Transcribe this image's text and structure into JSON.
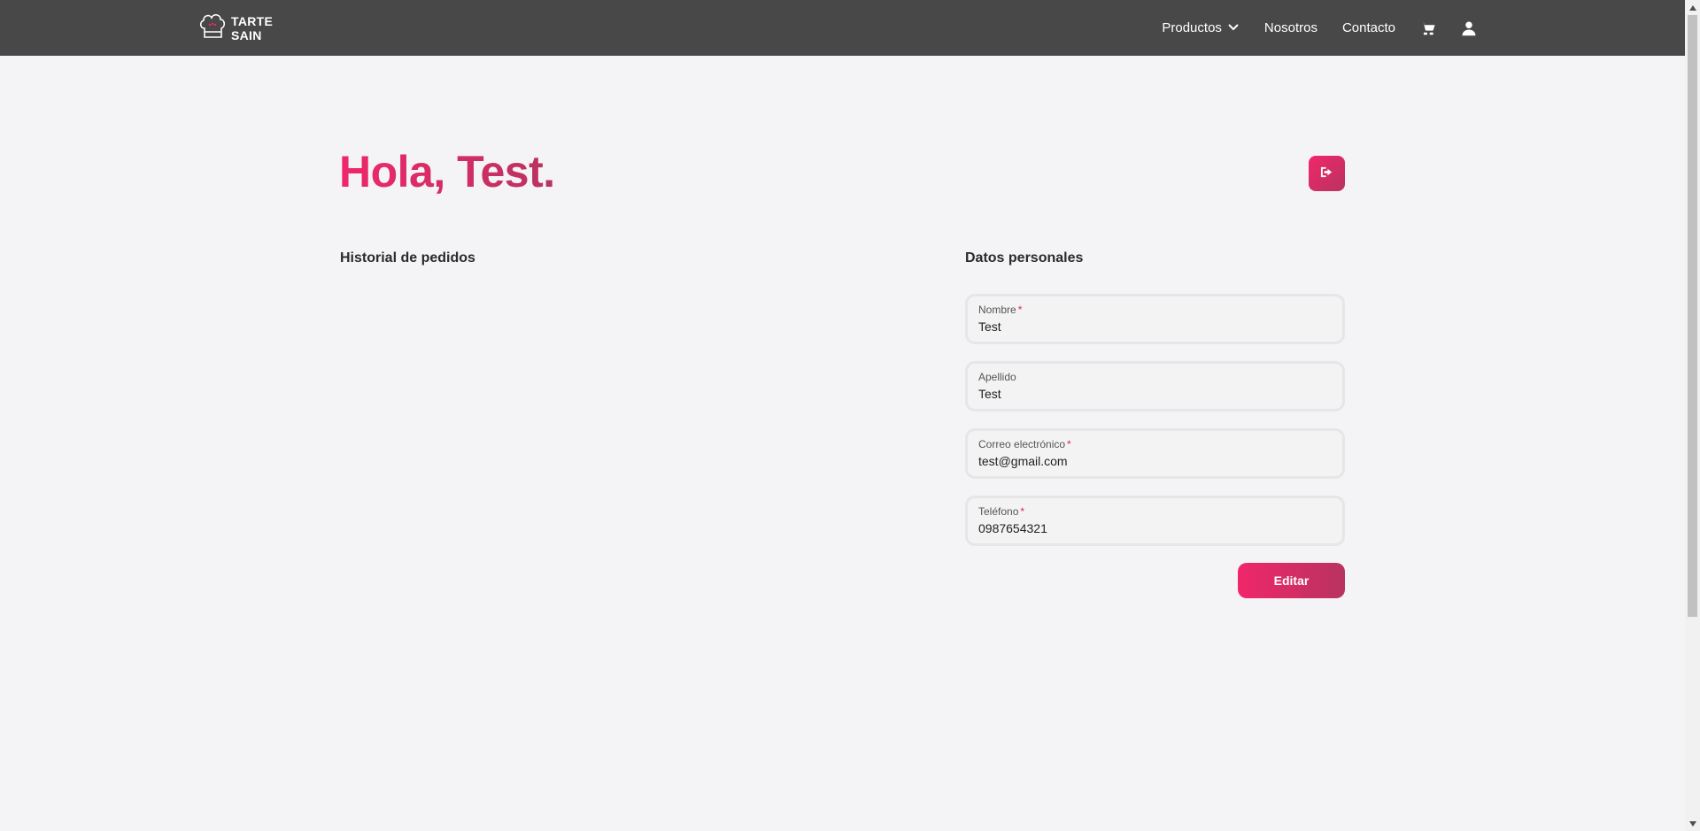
{
  "header": {
    "logo_line1": "TARTE",
    "logo_line2": "SAIN",
    "nav": {
      "productos": "Productos",
      "nosotros": "Nosotros",
      "contacto": "Contacto"
    }
  },
  "main": {
    "greeting": "Hola, Test.",
    "history_title": "Historial de pedidos",
    "personal_title": "Datos personales",
    "fields": [
      {
        "label": "Nombre",
        "required": "*",
        "value": "Test"
      },
      {
        "label": "Apellido",
        "required": "",
        "value": "Test"
      },
      {
        "label": "Correo electrónico",
        "required": "*",
        "value": "test@gmail.com"
      },
      {
        "label": "Teléfono",
        "required": "*",
        "value": "0987654321"
      }
    ],
    "edit_label": "Editar"
  },
  "icons": {
    "logo": "chef-hat-icon",
    "dropdown": "chevron-down-icon",
    "cart": "cart-icon",
    "user": "user-icon",
    "logout": "logout-icon"
  },
  "colors": {
    "header_bg": "#484848",
    "accent_start": "#f0276a",
    "accent_end": "#b8335f",
    "page_bg": "#f4f4f6"
  }
}
